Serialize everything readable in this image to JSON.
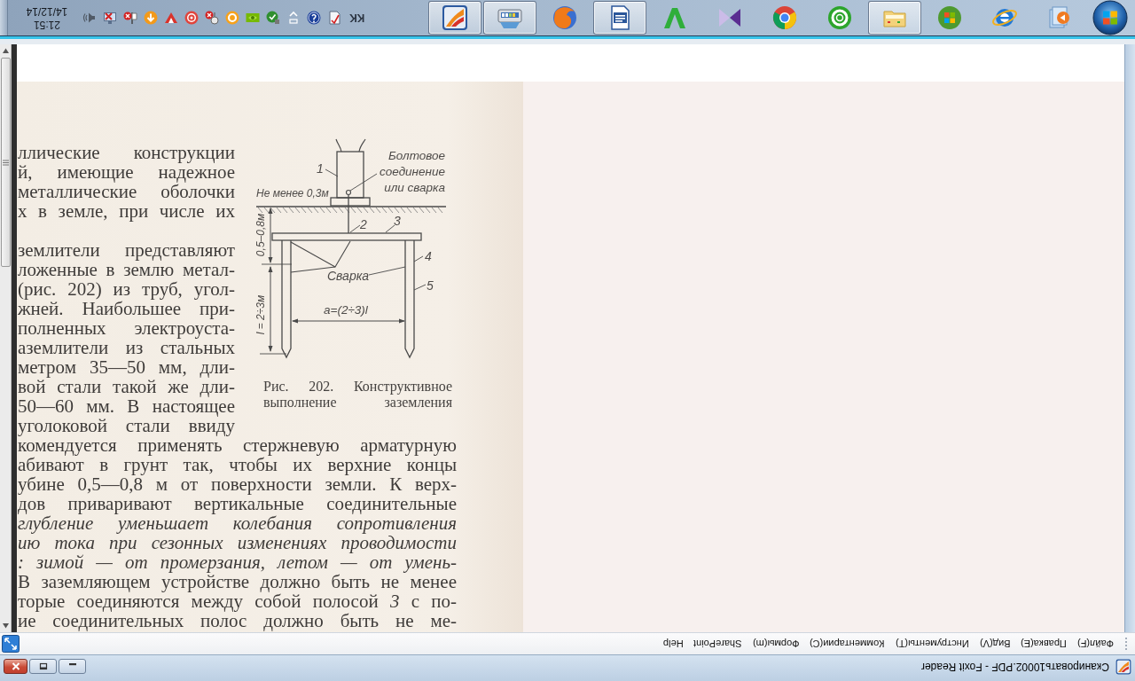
{
  "taskbar": {
    "clock": {
      "time": "21:51",
      "date": "14/12/14"
    },
    "language": "KK",
    "apps": [
      {
        "running": true
      },
      {
        "running": true
      },
      {
        "running": false
      },
      {
        "running": true
      },
      {
        "running": false
      },
      {
        "running": false
      },
      {
        "running": false
      },
      {
        "running": false
      },
      {
        "running": true
      },
      {
        "running": false
      },
      {
        "running": false
      },
      {
        "running": false
      }
    ]
  },
  "document": {
    "beside_figure": [
      {
        "lines": [
          "ллические конструкции",
          "й, имеющие надежное",
          "металлические оболочки",
          "х в земле, при числе их"
        ]
      },
      {
        "lines": [
          "землители представляют",
          "ложенные в землю метал-",
          "(рис. 202) из труб, угол-",
          "жней. Наибольшее при-",
          "полненных электроуста-",
          "аземлители из стальных",
          "метром 35—50 мм, дли-",
          "вой стали такой же дли-",
          "50—60 мм. В настоящее",
          "уголоковой стали ввиду"
        ]
      }
    ],
    "figure": {
      "labels": {
        "item_1": "1",
        "bolt_note": [
          "Болтовое",
          "соединение",
          "или сварка"
        ],
        "min_distance": "Не менее 0,3м",
        "depth": "0,5–0,8м",
        "item_2": "2",
        "item_3": "3",
        "item_4": "4",
        "weld": "Сварка",
        "item_5": "5",
        "length": "l = 2÷3м",
        "spacing": "a=(2÷3)l"
      },
      "caption": [
        "Рис. 202. Конструктивное",
        "выполнение заземления"
      ]
    },
    "full_width_lines": [
      {
        "text": "комендуется применять стержневую арматурную",
        "kind": "plain"
      },
      {
        "text": "абивают в грунт так, чтобы их верхние концы",
        "kind": "plain"
      },
      {
        "text": "убине 0,5—0,8 м от поверхности земли. К верх-",
        "kind": "plain"
      },
      {
        "text": "дов приваривают вертикальные соединительные",
        "kind": "plain"
      },
      {
        "text": "глубление уменьшает колебания сопротивления",
        "kind": "italic"
      },
      {
        "text": "ию тока при сезонных изменениях проводимости",
        "kind": "italic"
      },
      {
        "text": ": зимой — от промерзания, летом — от умень-",
        "kind": "italic"
      },
      {
        "text": "В заземляющем устройстве должно быть не менее",
        "kind": "plain"
      },
      {
        "text": "торые соединяются между собой полосой *3* с по-",
        "kind": "plain"
      },
      {
        "text": "ие соединительных полос должно быть не ме-",
        "kind": "plain"
      }
    ]
  },
  "menu_bar": {
    "items": [
      "Файл(F)",
      "Правка(E)",
      "Вид(V)",
      "Инструменты(T)",
      "Комментарии(C)",
      "Формы(m)",
      "SharePoint",
      "Help"
    ]
  },
  "window": {
    "title": "Сканировать10002.PDF - Foxit Reader"
  }
}
